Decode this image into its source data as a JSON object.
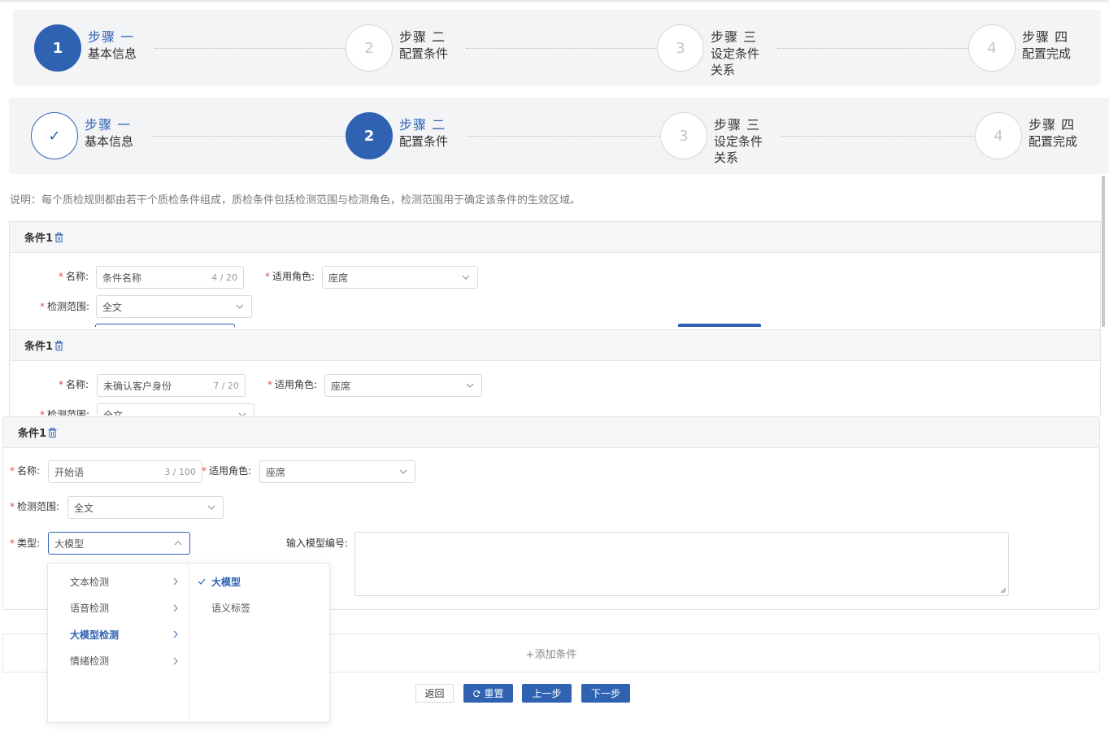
{
  "steps1": [
    {
      "num": "1",
      "title": "步骤 一",
      "desc": "基本信息"
    },
    {
      "num": "2",
      "title": "步骤 二",
      "desc": "配置条件"
    },
    {
      "num": "3",
      "title": "步骤 三",
      "desc": "设定条件关系"
    },
    {
      "num": "4",
      "title": "步骤 四",
      "desc": "配置完成"
    }
  ],
  "steps2": [
    {
      "num": "✓",
      "title": "步骤 一",
      "desc": "基本信息"
    },
    {
      "num": "2",
      "title": "步骤 二",
      "desc": "配置条件"
    },
    {
      "num": "3",
      "title": "步骤 三",
      "desc": "设定条件关系"
    },
    {
      "num": "4",
      "title": "步骤 四",
      "desc": "配置完成"
    }
  ],
  "note": "说明：每个质检规则都由若干个质检条件组成，质检条件包括检测范围与检测角色，检测范围用于确定该条件的生效区域。",
  "labels": {
    "name": "名称:",
    "role": "适用角色:",
    "scope": "检测范围:",
    "type": "类型:",
    "model_no": "输入模型编号:"
  },
  "card1": {
    "title": "条件1",
    "name_value": "条件名称",
    "name_count": "4 / 20",
    "role_value": "座席",
    "scope_value": "全文"
  },
  "card2": {
    "title": "条件1",
    "name_value": "未确认客户身份",
    "name_count": "7 / 20",
    "role_value": "座席",
    "scope_value": "全文"
  },
  "card3": {
    "title": "条件1",
    "name_value": "开始语",
    "name_count": "3 / 100",
    "role_value": "座席",
    "scope_value": "全文",
    "type_value": "大模型"
  },
  "dropdown": {
    "col1": [
      "文本检测",
      "语音检测",
      "大模型检测",
      "情绪检测"
    ],
    "col2": [
      "大模型",
      "语义标签"
    ]
  },
  "add_condition": "+添加条件",
  "buttons": {
    "back": "返回",
    "reset": "重置",
    "prev": "上一步",
    "next": "下一步"
  },
  "colors": {
    "primary": "#2f63b2",
    "required": "#e05050"
  }
}
